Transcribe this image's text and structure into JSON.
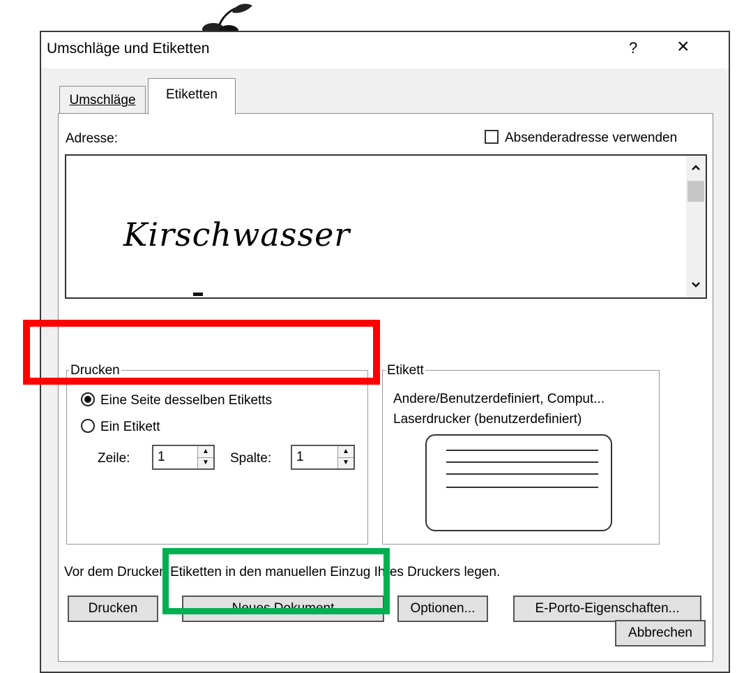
{
  "dialog": {
    "title": "Umschläge und Etiketten",
    "help_label": "?",
    "close_label": "×"
  },
  "tabs": [
    {
      "label": "Umschläge",
      "active": false
    },
    {
      "label": "Etiketten",
      "active": true
    }
  ],
  "address": {
    "label": "Adresse:",
    "use_return_address_label": "Absenderadresse verwenden",
    "use_return_address_checked": false,
    "content": "Kirschwasser"
  },
  "print_group": {
    "title": "Drucken",
    "options": [
      {
        "label": "Eine Seite desselben Etiketts",
        "selected": true
      },
      {
        "label": "Ein Etikett",
        "selected": false
      }
    ],
    "row_label": "Zeile:",
    "row_value": "1",
    "column_label": "Spalte:",
    "column_value": "1"
  },
  "label_group": {
    "title": "Etikett",
    "line1": "Andere/Benutzerdefiniert, Comput...",
    "line2": "Laserdrucker (benutzerdefiniert)"
  },
  "instruction": "Vor dem Drucken Etiketten in den manuellen Einzug Ihres Druckers legen.",
  "buttons": {
    "print": "Drucken",
    "new_document": "Neues Dokument",
    "options": "Optionen...",
    "eporto": "E-Porto-Eigenschaften...",
    "cancel": "Abbrechen"
  },
  "colors": {
    "highlight_red": "#ff0000",
    "highlight_green": "#00b050",
    "dialog_bg": "#f0f0f0",
    "button_bg": "#e1e1e1"
  },
  "icons": {
    "background_decoration": "cherry-icon"
  }
}
